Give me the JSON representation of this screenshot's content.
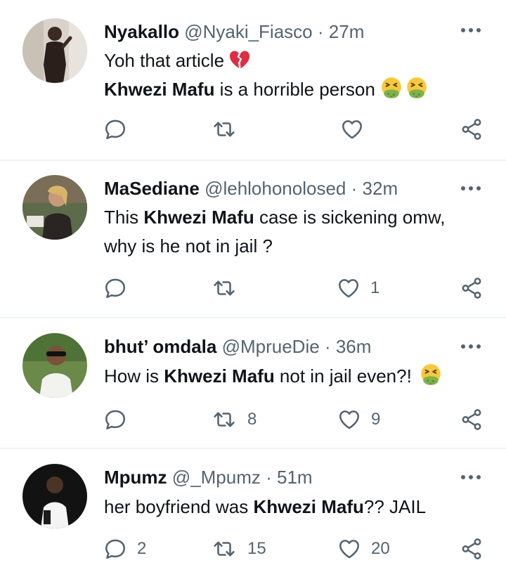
{
  "tweets": [
    {
      "name": "Nyakallo",
      "handle": "@Nyaki_Fiasco",
      "sep": "·",
      "time": "27m",
      "line1": "Yoh that article",
      "line1_emoji": "broken-heart-emoji",
      "line2_bold": "Khwezi Mafu",
      "line2_rest": " is a horrible person",
      "line2_emoji": "vomiting-face-emoji-x2",
      "reply_count": "",
      "retweet_count": "",
      "like_count": ""
    },
    {
      "name": "MaSediane",
      "handle": "@lehlohonolosed",
      "sep": "·",
      "time": "32m",
      "line1_pre": "This ",
      "line1_bold": "Khwezi Mafu",
      "line1_post": " case is sickening omw,",
      "line2": "why is he not in jail ?",
      "reply_count": "",
      "retweet_count": "",
      "like_count": "1"
    },
    {
      "name": "bhut’ omdala",
      "handle": "@MprueDie",
      "sep": "·",
      "time": "36m",
      "line1_pre": "How is ",
      "line1_bold": "Khwezi Mafu",
      "line1_post": " not in jail even?!",
      "line1_emoji": "vomiting-face-emoji",
      "reply_count": "",
      "retweet_count": "8",
      "like_count": "9"
    },
    {
      "name": "Mpumz",
      "handle": "@_Mpumz",
      "sep": "·",
      "time": "51m",
      "line1_pre": "her boyfriend was ",
      "line1_bold": "Khwezi Mafu",
      "line1_post": "?? JAIL",
      "reply_count": "2",
      "retweet_count": "15",
      "like_count": "20"
    }
  ],
  "icons": {
    "reply": "reply-icon",
    "retweet": "retweet-icon",
    "like": "heart-icon",
    "share": "share-icon",
    "more": "more-options-icon"
  },
  "colors": {
    "text": "#0f1419",
    "secondary": "#536471",
    "divider": "#eff3f4"
  }
}
